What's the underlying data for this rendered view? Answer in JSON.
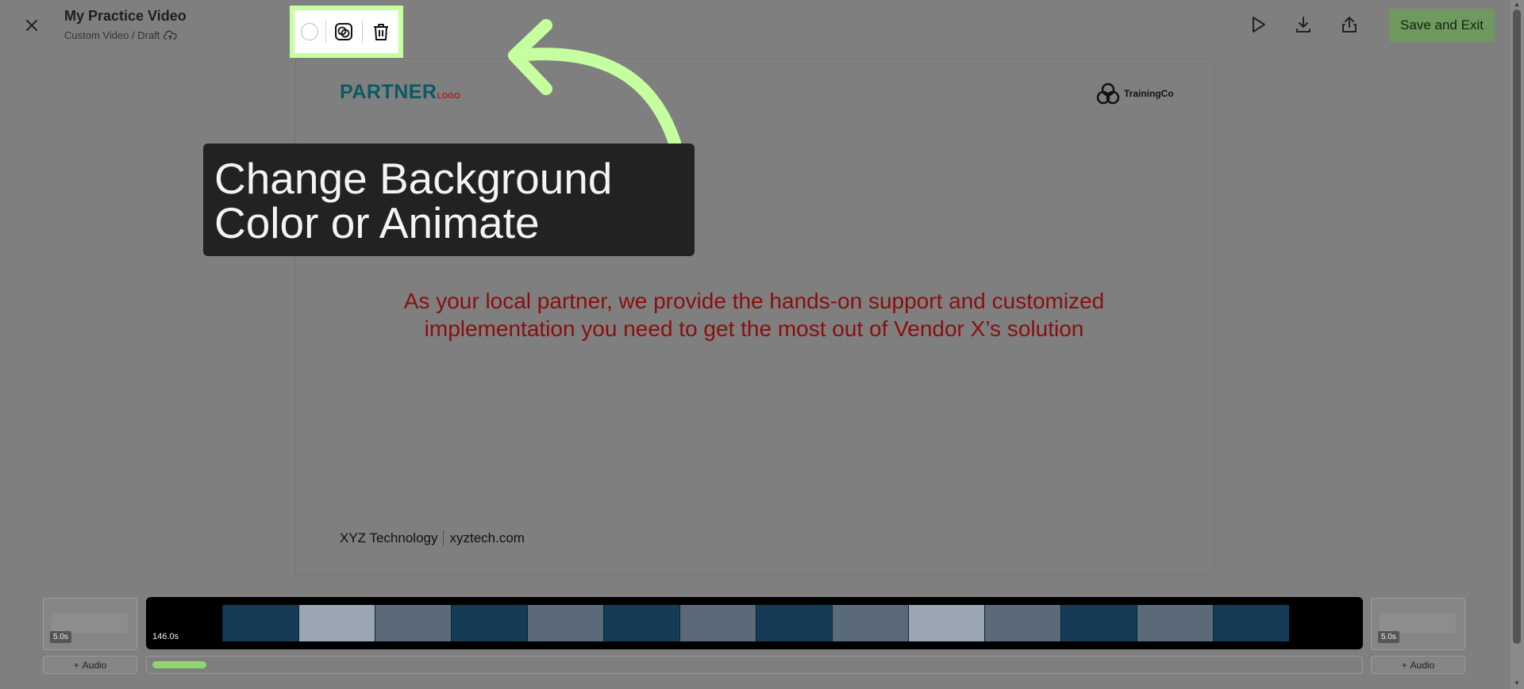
{
  "header": {
    "title": "My Practice Video",
    "subtitle": "Custom Video / Draft",
    "save_label": "Save and Exit"
  },
  "icons": {
    "close": "close-icon",
    "cloud": "cloud-upload-icon",
    "play": "play-icon",
    "download": "download-icon",
    "share": "share-icon",
    "color": "background-color-icon",
    "animate": "animate-icon",
    "delete": "trash-icon"
  },
  "slide": {
    "partner_logo_main": "PARTNER",
    "partner_logo_sub": "LOGO",
    "training_logo": "TrainingCo",
    "main_text": "As your local partner, we provide the hands-on support and customized implementation you need to get the most out of Vendor X’s solution",
    "footer_company": "XYZ Technology",
    "footer_url": "xyztech.com"
  },
  "callout": {
    "line1": "Change Background",
    "line2": "Color or Animate"
  },
  "timeline": {
    "intro_duration": "5.0s",
    "main_duration": "146.0s",
    "outro_duration": "5.0s",
    "audio_label": "Audio",
    "progress": 0.045
  },
  "colors": {
    "highlight": "#c5ff9f",
    "save_button": "#6e9a5f",
    "callout_bg": "#222222",
    "main_text": "#8b0e0e",
    "progress": "#8fd672"
  }
}
